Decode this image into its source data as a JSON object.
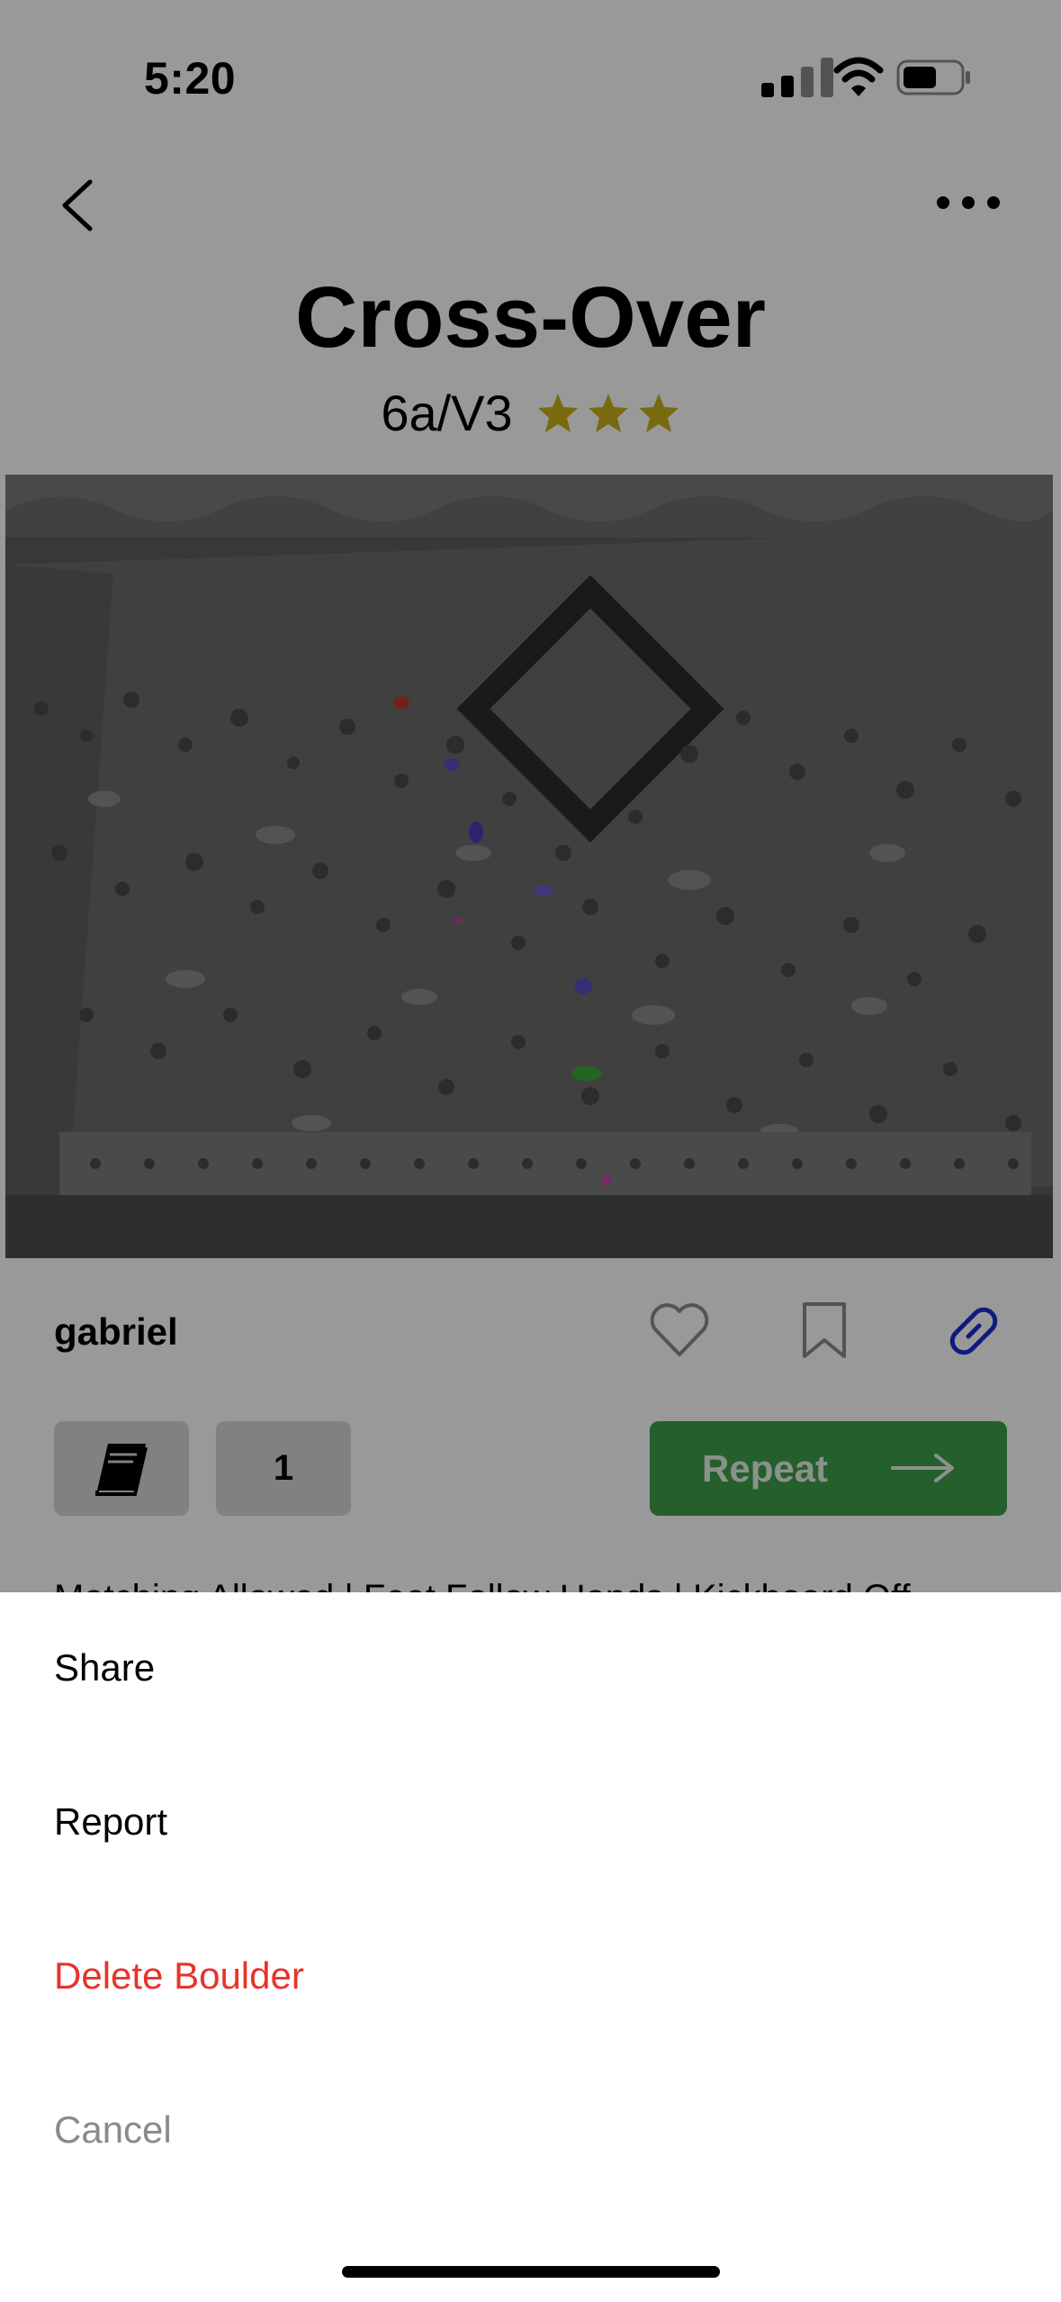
{
  "status_bar": {
    "time": "5:20"
  },
  "header": {
    "back_icon": "chevron-left-icon",
    "more_icon": "ellipsis-icon"
  },
  "boulder": {
    "name": "Cross-Over",
    "grade": "6a/V3",
    "stars": 3,
    "star_color": "#c9b21a",
    "setter": "gabriel",
    "sends": "1",
    "repeat_label": "Repeat",
    "description": "Matching Allowed | Feet Follow Hands | Kickboard Off"
  },
  "colors": {
    "accent_green": "#3f9f4a",
    "link_blue": "#1a2cd6",
    "danger": "#e8332b"
  },
  "action_sheet": {
    "share": "Share",
    "report": "Report",
    "delete": "Delete Boulder",
    "cancel": "Cancel"
  }
}
